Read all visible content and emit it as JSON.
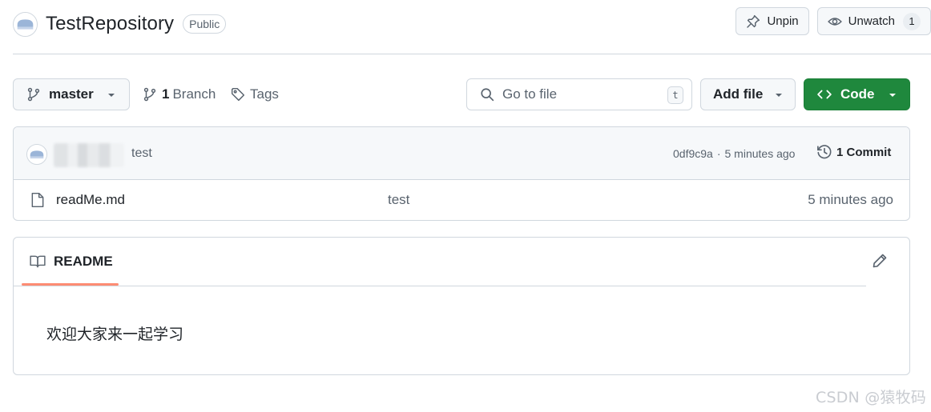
{
  "repo": {
    "name": "TestRepository",
    "visibility": "Public"
  },
  "header_actions": {
    "unpin_label": "Unpin",
    "unwatch_label": "Unwatch",
    "watchers_count": "1"
  },
  "toolbar": {
    "branch_name": "master",
    "branches_count": "1",
    "branches_label": "Branch",
    "tags_label": "Tags",
    "search_placeholder": "Go to file",
    "search_shortcut": "t",
    "add_file_label": "Add file",
    "code_label": "Code"
  },
  "latest_commit": {
    "message": "test",
    "sha": "0df9c9a",
    "separator": "·",
    "age": "5 minutes ago",
    "commits_count_label": "1 Commit"
  },
  "files": [
    {
      "name": "readMe.md",
      "commit_message": "test",
      "age": "5 minutes ago",
      "icon": "file-icon"
    }
  ],
  "readme": {
    "tab_label": "README",
    "content": "欢迎大家来一起学习"
  },
  "watermark": "CSDN @猿牧码",
  "colors": {
    "primary_button": "#1f883d",
    "active_tab_underline": "#fd8c73",
    "border": "#d0d7de",
    "muted_text": "#59636e"
  }
}
